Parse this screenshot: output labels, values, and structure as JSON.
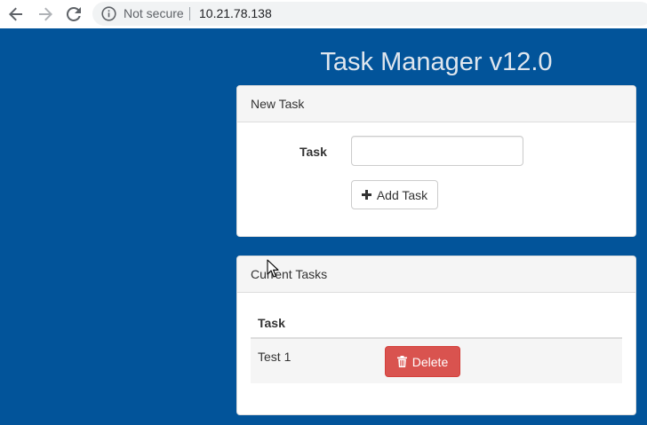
{
  "browser": {
    "security_label": "Not secure",
    "url": "10.21.78.138"
  },
  "page": {
    "title": "Task Manager v12.0",
    "background_color": "#02549a"
  },
  "new_task_panel": {
    "heading": "New Task",
    "task_label": "Task",
    "task_input_value": "",
    "add_button_label": "Add Task"
  },
  "current_tasks_panel": {
    "heading": "Current Tasks",
    "column_header": "Task",
    "rows": [
      {
        "name": "Test 1",
        "delete_label": "Delete"
      }
    ]
  },
  "colors": {
    "danger": "#d9534f",
    "panel_heading_bg": "#f5f5f5"
  },
  "icons": {
    "back": "arrow-left-icon",
    "forward": "arrow-right-icon",
    "reload": "reload-icon",
    "info": "info-icon",
    "add": "plus-icon",
    "delete": "trash-icon"
  }
}
